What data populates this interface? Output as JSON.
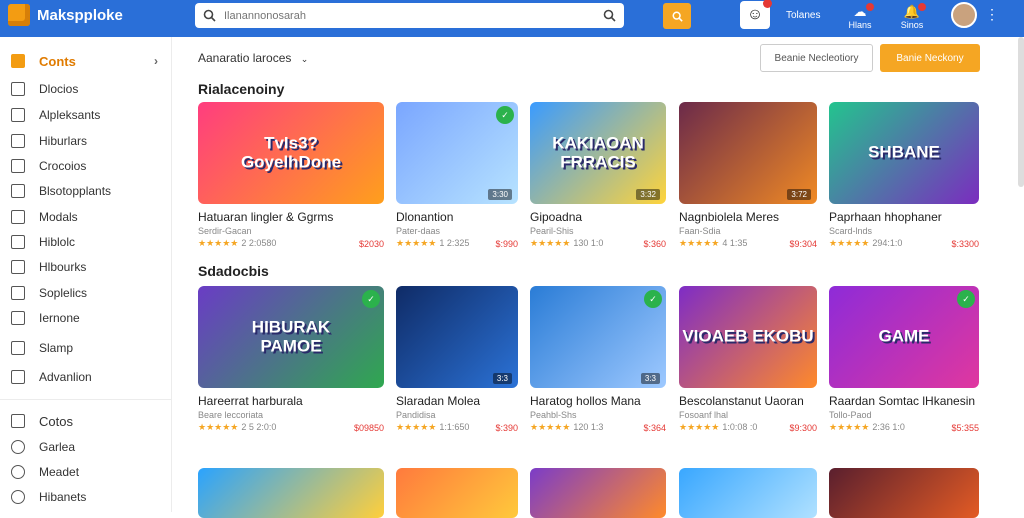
{
  "app": {
    "name": "Makspploke"
  },
  "search": {
    "placeholder": "Ilanannonosarah"
  },
  "header": {
    "tools_label": "Tolanes",
    "icon1_label": "Hlans",
    "icon2_label": "Sinos"
  },
  "sidebar": {
    "head1": "Conts",
    "items1": [
      "Dlocios",
      "Alpleksants",
      "Hiburlars",
      "Crocoios",
      "Blsotopplants",
      "Modals",
      "Hiblolc",
      "Hlbourks",
      "Soplelics",
      "Iernone",
      "Slamp",
      "Advanlion"
    ],
    "head2": "Cotos",
    "items2": [
      "Garlea",
      "Meadet",
      "Hibanets"
    ]
  },
  "main": {
    "filter_label": "Aanaratio laroces",
    "btn_secondary": "Beanie Necleotiory",
    "btn_primary": "Banie Neckony",
    "sections": [
      {
        "title": "Rialacenoiny",
        "cards": [
          {
            "thumb_text": "TvIs3?\nGoyelhDone",
            "title": "Hatuaran lingler & Ggrms",
            "sub": "Serdir-Gacan",
            "rating_count": "2 2:0580",
            "price": "$2030",
            "dl": "",
            "fav": ""
          },
          {
            "thumb_text": "",
            "title": "Dlonantion",
            "sub": "Pater-daas",
            "rating_count": "1 2:325",
            "price": "$:990",
            "dl": "3:30",
            "fav": "✓"
          },
          {
            "thumb_text": "KAKIAOAN\nFRRACIS",
            "title": "Gipoadna",
            "sub": "Pearil-Shis",
            "rating_count": "130 1:0",
            "price": "$:360",
            "dl": "3:32",
            "fav": ""
          },
          {
            "thumb_text": "",
            "title": "Nagnbiolela Meres",
            "sub": "Faan-Sdia",
            "rating_count": "4 1:35 ",
            "price": "$9:304",
            "dl": "3:72",
            "fav": ""
          },
          {
            "thumb_text": "SHBANE",
            "title": "Paprhaan hhophaner",
            "sub": "Scard-lnds",
            "rating_count": "294:1:0",
            "price": "$:3300",
            "dl": "",
            "fav": ""
          }
        ]
      },
      {
        "title": "Sdadocbis",
        "cards": [
          {
            "thumb_text": "HIBURAK\nPAMOE",
            "title": "Hareerrat harburala",
            "sub": "Beare leccoriata",
            "rating_count": "2 5 2:0:0",
            "price": "$09850",
            "dl": "",
            "fav": "✓"
          },
          {
            "thumb_text": "",
            "title": "Slaradan Molea",
            "sub": "Pandidisa",
            "rating_count": "1:1:650",
            "price": "$:390",
            "dl": "3:3",
            "fav": ""
          },
          {
            "thumb_text": "",
            "title": "Haratog hollos Mana",
            "sub": "Peahbl-Shs",
            "rating_count": "120 1:3",
            "price": "$:364",
            "dl": "3:3",
            "fav": "✓"
          },
          {
            "thumb_text": "VIOAEB EKOBU",
            "title": "Bescolanstanut Uaoran",
            "sub": "Fosoanf lhal",
            "rating_count": "1:0:08 :0",
            "price": "$9:300",
            "dl": "",
            "fav": ""
          },
          {
            "thumb_text": "GAME",
            "title": "Raardan Somtac lHkanesin",
            "sub": "Tollo-Paod",
            "rating_count": "2:36 1:0",
            "price": "$5:355",
            "dl": "",
            "fav": "✓"
          }
        ]
      }
    ]
  },
  "colors": {
    "topbar": "#2a6fd8",
    "accent": "#f5a623",
    "price": "#e53935"
  }
}
